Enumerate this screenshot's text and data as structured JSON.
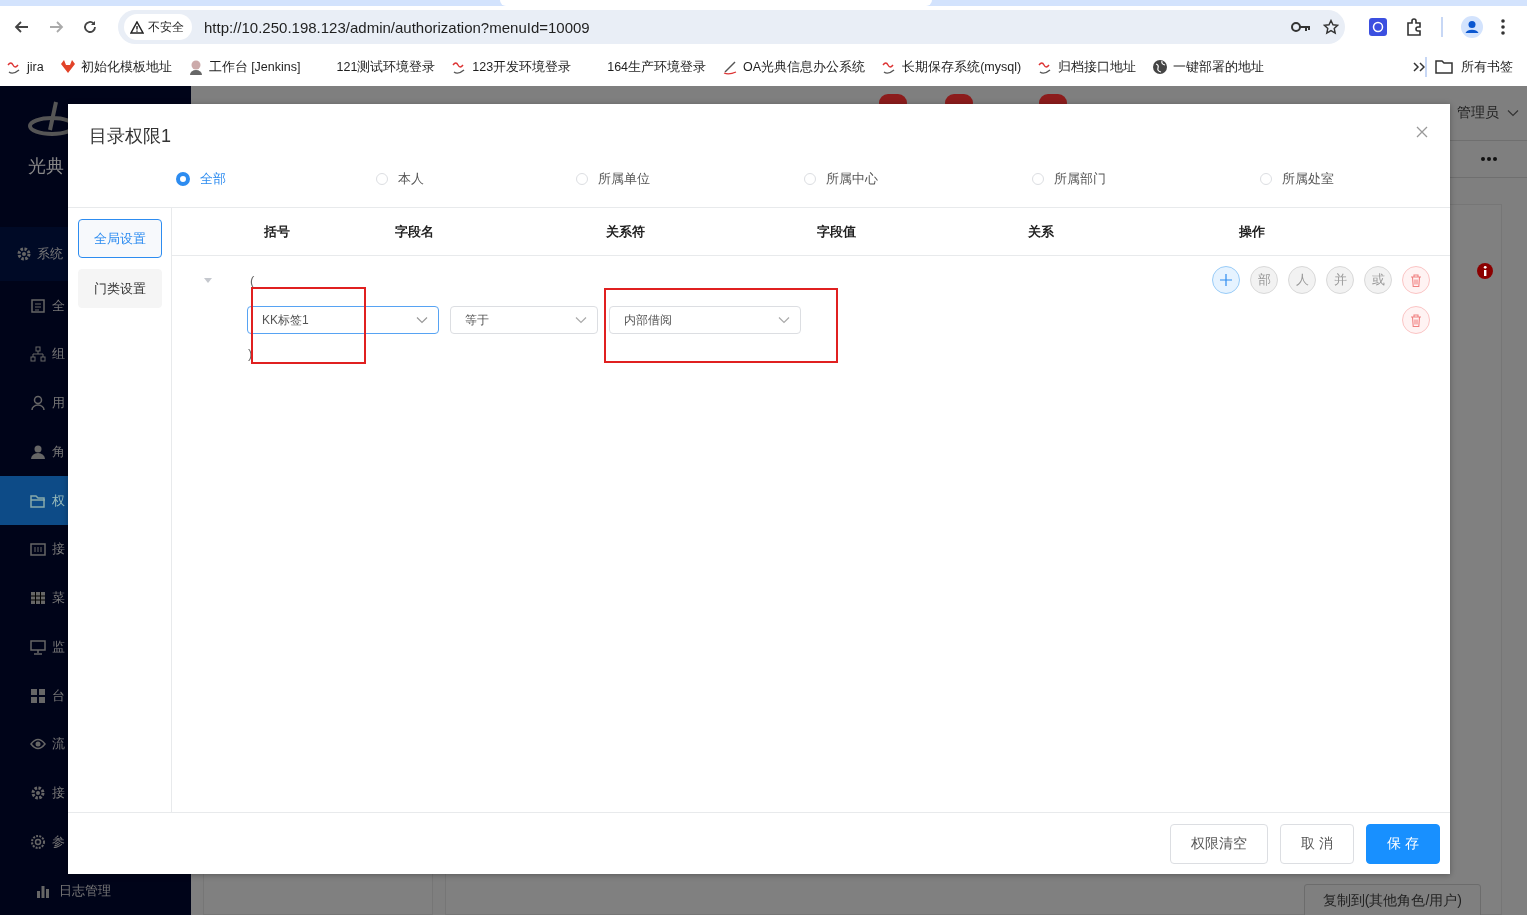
{
  "browser": {
    "security_label": "不安全",
    "url": "http://10.250.198.123/admin/authorization?menuId=10009",
    "all_bookmarks": "所有书签",
    "bookmarks": [
      {
        "label": "jira",
        "kind": "squiggle"
      },
      {
        "label": "初始化模板地址",
        "kind": "fox"
      },
      {
        "label": "工作台 [Jenkins]",
        "kind": "person"
      },
      {
        "label": "121测试环境登录",
        "kind": "none"
      },
      {
        "label": "123开发环境登录",
        "kind": "squiggle"
      },
      {
        "label": "164生产环境登录",
        "kind": "none"
      },
      {
        "label": "OA光典信息办公系统",
        "kind": "wand"
      },
      {
        "label": "长期保存系统(mysql)",
        "kind": "squiggle"
      },
      {
        "label": "归档接口地址",
        "kind": "squiggle"
      },
      {
        "label": "一键部署的地址",
        "kind": "globe"
      }
    ]
  },
  "app": {
    "logo_text": "光典",
    "user": "管理员",
    "copy_button": "复制到(其他角色/用户)",
    "sidebar": [
      {
        "label": "系统",
        "selected": false
      },
      {
        "label": "全",
        "selected": false
      },
      {
        "label": "组",
        "selected": false
      },
      {
        "label": "用",
        "selected": false
      },
      {
        "label": "角",
        "selected": false
      },
      {
        "label": "权",
        "selected": true
      },
      {
        "label": "接",
        "selected": false
      },
      {
        "label": "菜",
        "selected": false
      },
      {
        "label": "监",
        "selected": false
      },
      {
        "label": "台",
        "selected": false
      },
      {
        "label": "流",
        "selected": false
      },
      {
        "label": "接",
        "selected": false
      },
      {
        "label": "参",
        "selected": false
      },
      {
        "label": "日志管理",
        "selected": false
      }
    ]
  },
  "dialog": {
    "title": "目录权限1",
    "scopes": [
      {
        "label": "全部",
        "selected": true
      },
      {
        "label": "本人",
        "selected": false
      },
      {
        "label": "所属单位",
        "selected": false
      },
      {
        "label": "所属中心",
        "selected": false
      },
      {
        "label": "所属部门",
        "selected": false
      },
      {
        "label": "所属处室",
        "selected": false
      }
    ],
    "sections": [
      {
        "label": "全局设置",
        "selected": true
      },
      {
        "label": "门类设置",
        "selected": false
      }
    ],
    "columns": [
      "括号",
      "字段名",
      "关系符",
      "字段值",
      "关系",
      "操作"
    ],
    "group": {
      "expanded": true,
      "open_bracket": "(",
      "close_bracket": ")",
      "actions": [
        {
          "kind": "add"
        },
        {
          "kind": "text",
          "label": "部"
        },
        {
          "kind": "text",
          "label": "人"
        },
        {
          "kind": "text",
          "label": "并"
        },
        {
          "kind": "text",
          "label": "或"
        },
        {
          "kind": "delete"
        }
      ],
      "conditions": [
        {
          "field": {
            "value": "KK标签1",
            "focused": true,
            "highlighted": true
          },
          "operator": {
            "value": "等于",
            "focused": false,
            "highlighted": false
          },
          "value": {
            "value": "内部借阅",
            "focused": false,
            "highlighted": true
          },
          "actions": [
            {
              "kind": "delete"
            }
          ]
        }
      ]
    },
    "buttons": [
      {
        "label": "权限清空",
        "kind": "default"
      },
      {
        "label": "取 消",
        "kind": "default"
      },
      {
        "label": "保 存",
        "kind": "primary"
      }
    ]
  }
}
